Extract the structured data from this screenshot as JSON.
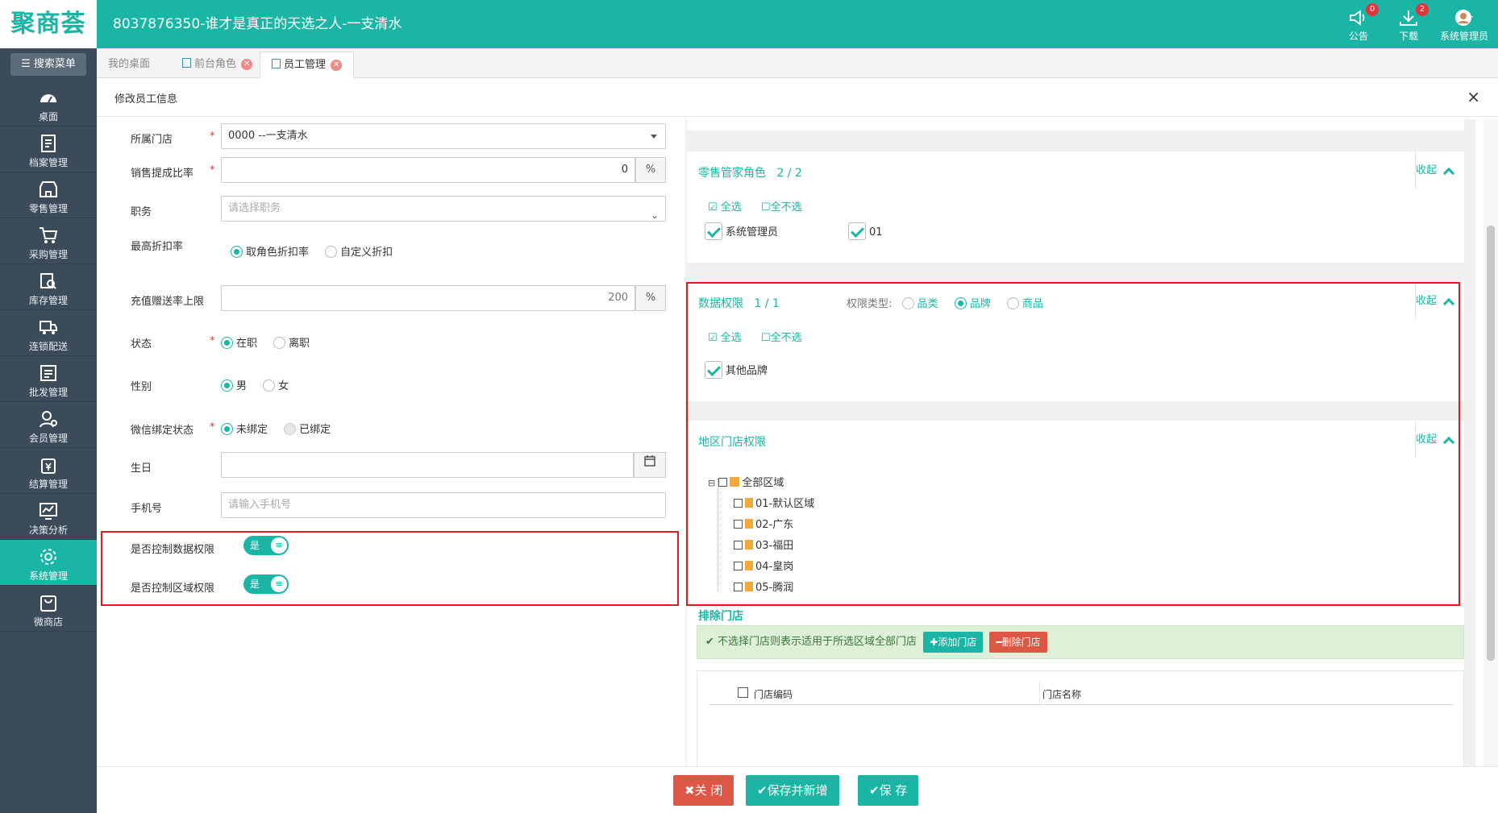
{
  "brand": {
    "logo": "聚商荟",
    "title": "8037876350-谁才是真正的天选之人-一支清水",
    "accent": "#1ab5a5"
  },
  "top_tools": [
    {
      "label": "公告",
      "badge": "0",
      "icon": "speaker-icon"
    },
    {
      "label": "下载",
      "badge": "2",
      "icon": "download-icon"
    },
    {
      "label": "系统管理员",
      "icon": "user-avatar-icon"
    }
  ],
  "sidebar": {
    "search_label": "搜索菜单",
    "items": [
      {
        "label": "桌面",
        "icon": "dashboard-icon"
      },
      {
        "label": "档案管理",
        "icon": "archive-icon"
      },
      {
        "label": "零售管理",
        "icon": "store-icon"
      },
      {
        "label": "采购管理",
        "icon": "cart-icon"
      },
      {
        "label": "库存管理",
        "icon": "inventory-icon"
      },
      {
        "label": "连锁配送",
        "icon": "truck-icon"
      },
      {
        "label": "批发管理",
        "icon": "wholesale-icon"
      },
      {
        "label": "会员管理",
        "icon": "member-icon"
      },
      {
        "label": "结算管理",
        "icon": "settlement-icon"
      },
      {
        "label": "决策分析",
        "icon": "chart-icon"
      },
      {
        "label": "系统管理",
        "icon": "gear-icon",
        "active": true
      },
      {
        "label": "微商店",
        "icon": "bag-icon"
      }
    ]
  },
  "tabs": [
    {
      "label": "我的桌面"
    },
    {
      "label": "前台角色"
    },
    {
      "label": "员工管理",
      "active": true
    }
  ],
  "dialog": {
    "title": "修改员工信息",
    "close": "×"
  },
  "form": {
    "store": {
      "label": "所属门店",
      "value": "0000 --一支清水"
    },
    "commission": {
      "label": "销售提成比率",
      "value": "0",
      "unit": "%"
    },
    "position": {
      "label": "职务",
      "placeholder": "请选择职务"
    },
    "max_discount": {
      "label": "最高折扣率",
      "options": [
        "取角色折扣率",
        "自定义折扣"
      ],
      "selected": "取角色折扣率"
    },
    "recharge_limit": {
      "label": "充值赠送率上限",
      "value": "200",
      "unit": "%"
    },
    "status": {
      "label": "状态",
      "options": [
        "在职",
        "离职"
      ],
      "selected": "在职"
    },
    "gender": {
      "label": "性别",
      "options": [
        "男",
        "女"
      ],
      "selected": "男"
    },
    "wechat": {
      "label": "微信绑定状态",
      "options": [
        "未绑定",
        "已绑定"
      ],
      "selected": "未绑定"
    },
    "birthday": {
      "label": "生日",
      "value": ""
    },
    "phone": {
      "label": "手机号",
      "placeholder": "请输入手机号"
    },
    "control_data": {
      "label": "是否控制数据权限",
      "toggle": "是"
    },
    "control_region": {
      "label": "是否控制区域权限",
      "toggle": "是"
    }
  },
  "retail_role": {
    "title": "零售管家角色",
    "count": "2 / 2",
    "collapse": "收起",
    "select_all": "全选",
    "select_none": "全不选",
    "items": [
      {
        "label": "系统管理员",
        "checked": true
      },
      {
        "label": "01",
        "checked": true
      }
    ]
  },
  "data_perm": {
    "title": "数据权限",
    "count": "1 / 1",
    "type_label": "权限类型:",
    "types": [
      "品类",
      "品牌",
      "商品"
    ],
    "selected_type": "品牌",
    "collapse": "收起",
    "select_all": "全选",
    "select_none": "全不选",
    "items": [
      {
        "label": "其他品牌",
        "checked": true
      }
    ]
  },
  "region_perm": {
    "title": "地区门店权限",
    "collapse": "收起",
    "root": "全部区域",
    "regions": [
      "01-默认区域",
      "02-广东",
      "03-福田",
      "04-皇岗",
      "05-腾润"
    ]
  },
  "exclude": {
    "title": "排除门店",
    "notice": "不选择门店则表示适用于所选区域全部门店",
    "add_btn": "添加门店",
    "del_btn": "删除门店",
    "columns": [
      "门店编码",
      "门店名称"
    ]
  },
  "footer": {
    "close": "关 闭",
    "save_new": "保存并新增",
    "save": "保 存"
  }
}
